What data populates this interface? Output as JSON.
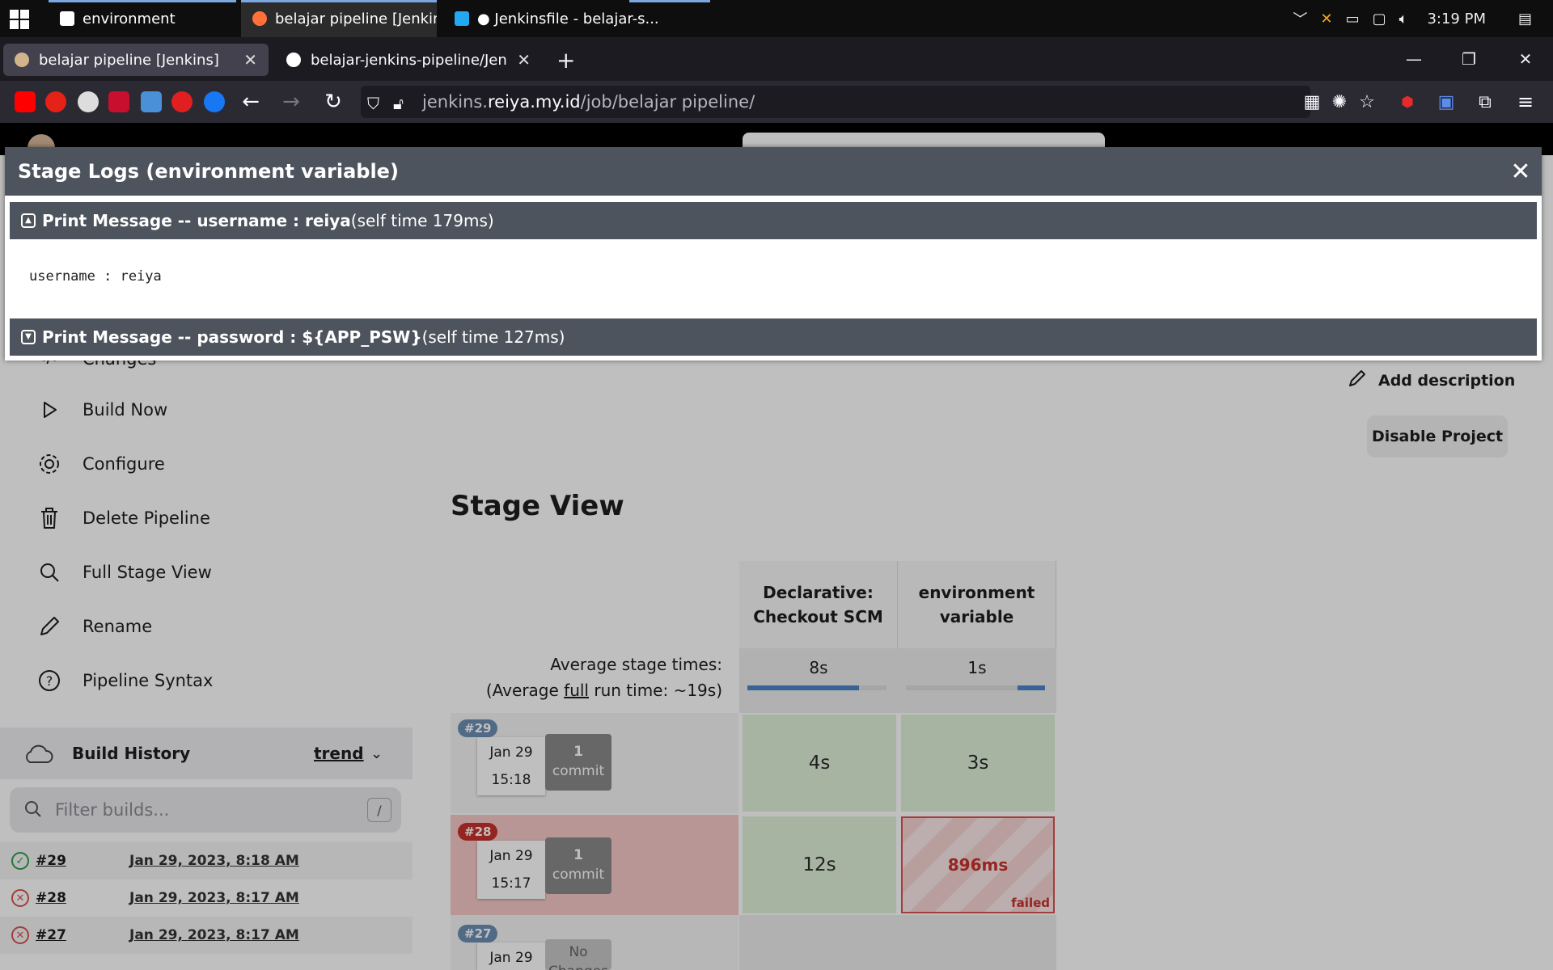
{
  "taskbar": {
    "tasks": [
      {
        "label": "environment",
        "icon": "notion-icon"
      },
      {
        "label": "belajar pipeline [Jenkin...",
        "icon": "firefox-icon"
      },
      {
        "label": "● Jenkinsfile - belajar-s...",
        "icon": "vscode-icon"
      }
    ],
    "clock": "3:19 PM"
  },
  "browser": {
    "tabs": [
      {
        "title": "belajar pipeline [Jenkins]",
        "close": "✕"
      },
      {
        "title": "belajar-jenkins-pipeline/Jenkinsfile",
        "close": "✕"
      }
    ],
    "new_tab": "+",
    "url_host_prefix": "jenkins.",
    "url_host_main": "reiya.my.id",
    "url_path": "/job/belajar pipeline/"
  },
  "sidebar": {
    "partial_item": "Changes",
    "items": [
      {
        "label": "Build Now",
        "icon": "play-icon"
      },
      {
        "label": "Configure",
        "icon": "gear-icon"
      },
      {
        "label": "Delete Pipeline",
        "icon": "trash-icon"
      },
      {
        "label": "Full Stage View",
        "icon": "search-icon"
      },
      {
        "label": "Rename",
        "icon": "pencil-icon"
      },
      {
        "label": "Pipeline Syntax",
        "icon": "help-icon"
      }
    ]
  },
  "build_history": {
    "title": "Build History",
    "trend_label": "trend",
    "filter_placeholder": "Filter builds...",
    "filter_shortcut": "/",
    "rows": [
      {
        "number": "#29",
        "date": "Jan 29, 2023, 8:18 AM",
        "status": "success"
      },
      {
        "number": "#28",
        "date": "Jan 29, 2023, 8:17 AM",
        "status": "failed"
      },
      {
        "number": "#27",
        "date": "Jan 29, 2023, 8:17 AM",
        "status": "failed"
      }
    ]
  },
  "main": {
    "add_description": "Add description",
    "disable_project": "Disable Project",
    "stage_view_title": "Stage View"
  },
  "stage_view": {
    "columns": [
      {
        "name": "Declarative: Checkout SCM",
        "avg": "8s",
        "avg_fraction": 0.8
      },
      {
        "name": "environment variable",
        "avg": "1s",
        "avg_fraction": 0.2
      }
    ],
    "avg_label_line1": "Average stage times:",
    "avg_label_line2_a": "(Average ",
    "avg_label_line2_b": "full",
    "avg_label_line2_c": " run time: ~19s)",
    "runs": [
      {
        "badge": "#29",
        "date": "Jan 29",
        "time": "15:18",
        "commits_count": "1",
        "commits_label": "commit",
        "cells": [
          "4s",
          "3s"
        ],
        "status": "success"
      },
      {
        "badge": "#28",
        "date": "Jan 29",
        "time": "15:17",
        "commits_count": "1",
        "commits_label": "commit",
        "cells": [
          "12s",
          "896ms"
        ],
        "failed_label": "failed",
        "status": "failed"
      },
      {
        "badge": "#27",
        "date": "Jan 29",
        "commits_count": "No",
        "commits_label": "Changes",
        "status": "unknown"
      }
    ]
  },
  "modal": {
    "title": "Stage Logs (environment variable)",
    "close": "✕",
    "logs": [
      {
        "header_bold": "Print Message -- username : reiya",
        "header_rest": " (self time 179ms)",
        "body": "username : reiya",
        "expanded": true
      },
      {
        "header_bold": "Print Message -- password : ${APP_PSW}",
        "header_rest": " (self time 127ms)",
        "expanded": false
      }
    ]
  },
  "colors": {
    "taskbar_bg": "#0e0e0e",
    "modal_header": "#4d545d",
    "success_cell": "#dff0d8",
    "failed_border": "#d9534f",
    "badge_blue": "#6d8fb3",
    "badge_red": "#c9302c"
  }
}
